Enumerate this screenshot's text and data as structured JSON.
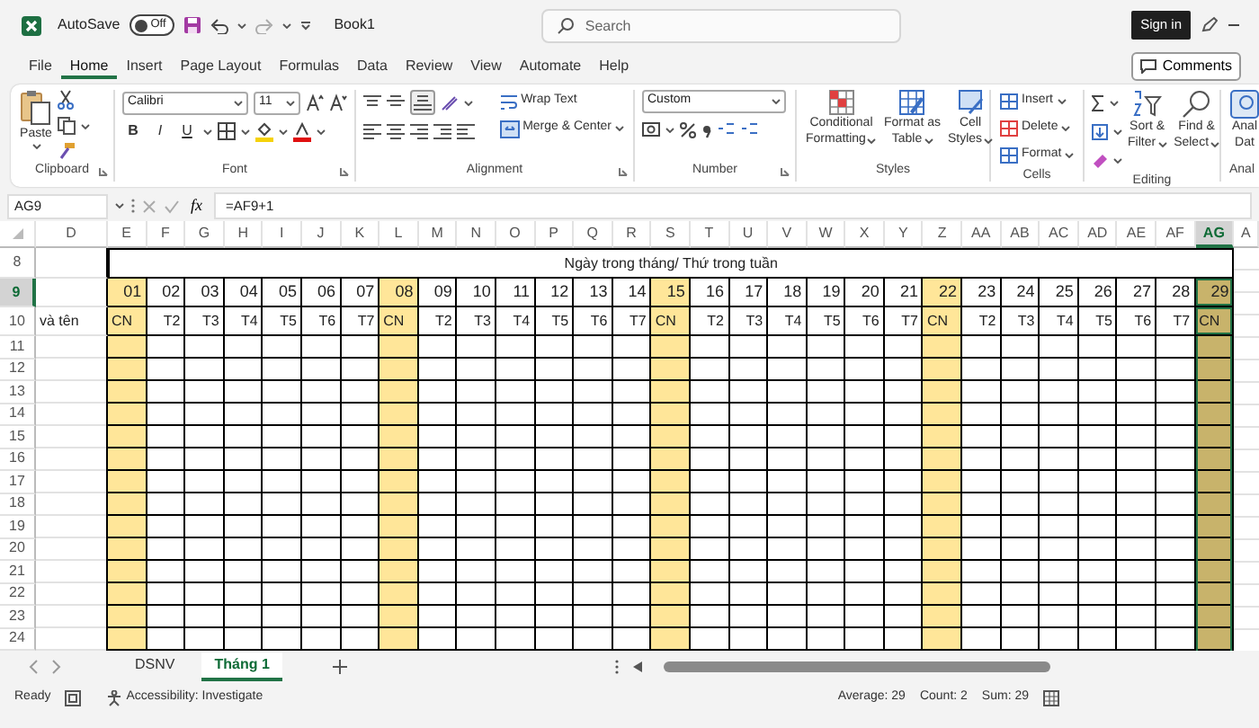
{
  "title_bar": {
    "autosave_label": "AutoSave",
    "autosave_toggle": {
      "label": "Off",
      "on": false
    },
    "document_title": "Book1",
    "search": {
      "placeholder": "Search"
    },
    "sign_in": "Sign in"
  },
  "menu_tabs": [
    {
      "label": "File",
      "selected": false
    },
    {
      "label": "Home",
      "selected": true
    },
    {
      "label": "Insert",
      "selected": false
    },
    {
      "label": "Page Layout",
      "selected": false
    },
    {
      "label": "Formulas",
      "selected": false
    },
    {
      "label": "Data",
      "selected": false
    },
    {
      "label": "Review",
      "selected": false
    },
    {
      "label": "View",
      "selected": false
    },
    {
      "label": "Automate",
      "selected": false
    },
    {
      "label": "Help",
      "selected": false
    }
  ],
  "comments_button": "Comments",
  "ribbon": {
    "clipboard": {
      "paste": "Paste",
      "label": "Clipboard"
    },
    "font": {
      "name": "Calibri",
      "size": "11",
      "style_buttons": [
        "B",
        "I",
        "U"
      ],
      "label": "Font"
    },
    "alignment": {
      "wrap_text": "Wrap Text",
      "merge_center": "Merge & Center",
      "label": "Alignment"
    },
    "number": {
      "format": "Custom",
      "label": "Number"
    },
    "styles": {
      "buttons": [
        {
          "line1": "Conditional",
          "line2": "Formatting"
        },
        {
          "line1": "Format as",
          "line2": "Table"
        },
        {
          "line1": "Cell",
          "line2": "Styles"
        }
      ],
      "label": "Styles"
    },
    "cells": {
      "buttons": [
        "Insert",
        "Delete",
        "Format"
      ],
      "label": "Cells"
    },
    "editing": {
      "buttons": [
        {
          "line1": "Sort &",
          "line2": "Filter"
        },
        {
          "line1": "Find &",
          "line2": "Select"
        }
      ],
      "label": "Editing"
    },
    "analysis": {
      "line1": "Anal",
      "line2": "Dat",
      "label": "Anal"
    }
  },
  "formula_bar": {
    "name_box": "AG9",
    "fx": "fx",
    "formula": "=AF9+1"
  },
  "sheet": {
    "columns": [
      {
        "label": "D",
        "selected": false
      },
      {
        "label": "E",
        "selected": false
      },
      {
        "label": "F",
        "selected": false
      },
      {
        "label": "G",
        "selected": false
      },
      {
        "label": "H",
        "selected": false
      },
      {
        "label": "I",
        "selected": false
      },
      {
        "label": "J",
        "selected": false
      },
      {
        "label": "K",
        "selected": false
      },
      {
        "label": "L",
        "selected": false
      },
      {
        "label": "M",
        "selected": false
      },
      {
        "label": "N",
        "selected": false
      },
      {
        "label": "O",
        "selected": false
      },
      {
        "label": "P",
        "selected": false
      },
      {
        "label": "Q",
        "selected": false
      },
      {
        "label": "R",
        "selected": false
      },
      {
        "label": "S",
        "selected": false
      },
      {
        "label": "T",
        "selected": false
      },
      {
        "label": "U",
        "selected": false
      },
      {
        "label": "V",
        "selected": false
      },
      {
        "label": "W",
        "selected": false
      },
      {
        "label": "X",
        "selected": false
      },
      {
        "label": "Y",
        "selected": false
      },
      {
        "label": "Z",
        "selected": false
      },
      {
        "label": "AA",
        "selected": false
      },
      {
        "label": "AB",
        "selected": false
      },
      {
        "label": "AC",
        "selected": false
      },
      {
        "label": "AD",
        "selected": false
      },
      {
        "label": "AE",
        "selected": false
      },
      {
        "label": "AF",
        "selected": false
      },
      {
        "label": "AG",
        "selected": true
      },
      {
        "label": "A",
        "selected": false
      }
    ],
    "rows": [
      {
        "label": "8",
        "selected": false
      },
      {
        "label": "9",
        "selected": true
      },
      {
        "label": "10",
        "selected": false
      },
      {
        "label": "11",
        "selected": false
      },
      {
        "label": "12",
        "selected": false
      },
      {
        "label": "13",
        "selected": false
      },
      {
        "label": "14",
        "selected": false
      },
      {
        "label": "15",
        "selected": false
      },
      {
        "label": "16",
        "selected": false
      },
      {
        "label": "17",
        "selected": false
      },
      {
        "label": "18",
        "selected": false
      },
      {
        "label": "19",
        "selected": false
      },
      {
        "label": "20",
        "selected": false
      },
      {
        "label": "21",
        "selected": false
      },
      {
        "label": "22",
        "selected": false
      },
      {
        "label": "23",
        "selected": false
      },
      {
        "label": "24",
        "selected": false
      }
    ],
    "header_title": "Ngày trong tháng/ Thứ trong tuần",
    "name_heading": "và tên",
    "days": [
      {
        "day": "01",
        "weekday": "CN",
        "highlighted": true,
        "selected": false
      },
      {
        "day": "02",
        "weekday": "T2",
        "highlighted": false,
        "selected": false
      },
      {
        "day": "03",
        "weekday": "T3",
        "highlighted": false,
        "selected": false
      },
      {
        "day": "04",
        "weekday": "T4",
        "highlighted": false,
        "selected": false
      },
      {
        "day": "05",
        "weekday": "T5",
        "highlighted": false,
        "selected": false
      },
      {
        "day": "06",
        "weekday": "T6",
        "highlighted": false,
        "selected": false
      },
      {
        "day": "07",
        "weekday": "T7",
        "highlighted": false,
        "selected": false
      },
      {
        "day": "08",
        "weekday": "CN",
        "highlighted": true,
        "selected": false
      },
      {
        "day": "09",
        "weekday": "T2",
        "highlighted": false,
        "selected": false
      },
      {
        "day": "10",
        "weekday": "T3",
        "highlighted": false,
        "selected": false
      },
      {
        "day": "11",
        "weekday": "T4",
        "highlighted": false,
        "selected": false
      },
      {
        "day": "12",
        "weekday": "T5",
        "highlighted": false,
        "selected": false
      },
      {
        "day": "13",
        "weekday": "T6",
        "highlighted": false,
        "selected": false
      },
      {
        "day": "14",
        "weekday": "T7",
        "highlighted": false,
        "selected": false
      },
      {
        "day": "15",
        "weekday": "CN",
        "highlighted": true,
        "selected": false
      },
      {
        "day": "16",
        "weekday": "T2",
        "highlighted": false,
        "selected": false
      },
      {
        "day": "17",
        "weekday": "T3",
        "highlighted": false,
        "selected": false
      },
      {
        "day": "18",
        "weekday": "T4",
        "highlighted": false,
        "selected": false
      },
      {
        "day": "19",
        "weekday": "T5",
        "highlighted": false,
        "selected": false
      },
      {
        "day": "20",
        "weekday": "T6",
        "highlighted": false,
        "selected": false
      },
      {
        "day": "21",
        "weekday": "T7",
        "highlighted": false,
        "selected": false
      },
      {
        "day": "22",
        "weekday": "CN",
        "highlighted": true,
        "selected": false
      },
      {
        "day": "23",
        "weekday": "T2",
        "highlighted": false,
        "selected": false
      },
      {
        "day": "24",
        "weekday": "T3",
        "highlighted": false,
        "selected": false
      },
      {
        "day": "25",
        "weekday": "T4",
        "highlighted": false,
        "selected": false
      },
      {
        "day": "26",
        "weekday": "T5",
        "highlighted": false,
        "selected": false
      },
      {
        "day": "27",
        "weekday": "T6",
        "highlighted": false,
        "selected": false
      },
      {
        "day": "28",
        "weekday": "T7",
        "highlighted": false,
        "selected": false
      },
      {
        "day": "29",
        "weekday": "CN",
        "highlighted": true,
        "selected": true
      }
    ]
  },
  "sheet_tabs": [
    {
      "label": "DSNV",
      "selected": false
    },
    {
      "label": "Tháng 1",
      "selected": true
    }
  ],
  "status_bar": {
    "mode": "Ready",
    "accessibility": "Accessibility: Investigate",
    "average": "Average: 29",
    "count": "Count: 2",
    "sum": "Sum: 29"
  }
}
